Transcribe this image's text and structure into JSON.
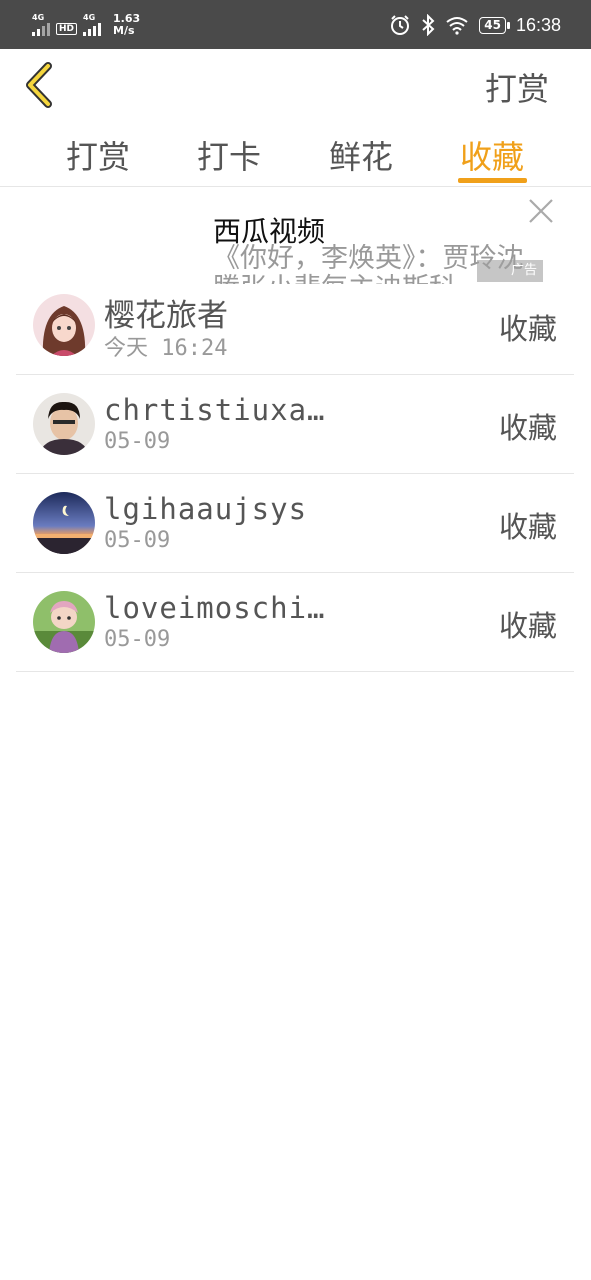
{
  "statusbar": {
    "net1": "4G",
    "hd": "HD",
    "net2": "4G",
    "speed_value": "1.63",
    "speed_unit": "M/s",
    "battery": "45",
    "time": "16:38"
  },
  "header": {
    "title": "打赏"
  },
  "tabs": [
    {
      "label": "打赏"
    },
    {
      "label": "打卡"
    },
    {
      "label": "鲜花"
    },
    {
      "label": "收藏",
      "active": true
    }
  ],
  "ad": {
    "title": "西瓜视频",
    "description": "《你好，李焕英》：贾玲沈腾张小斐每主迪斯科",
    "badge": "广告"
  },
  "rows": [
    {
      "name": "樱花旅者",
      "date": "今天 16:24",
      "action": "收藏"
    },
    {
      "name": "chrtistiuxa…",
      "date": "05-09",
      "action": "收藏"
    },
    {
      "name": "lgihaaujsys",
      "date": "05-09",
      "action": "收藏"
    },
    {
      "name": "loveimoschi…",
      "date": "05-09",
      "action": "收藏"
    }
  ],
  "colors": {
    "accent": "#f0a01a",
    "statusbar": "#4a4a4a",
    "text": "#555555",
    "secondary": "#999999"
  }
}
